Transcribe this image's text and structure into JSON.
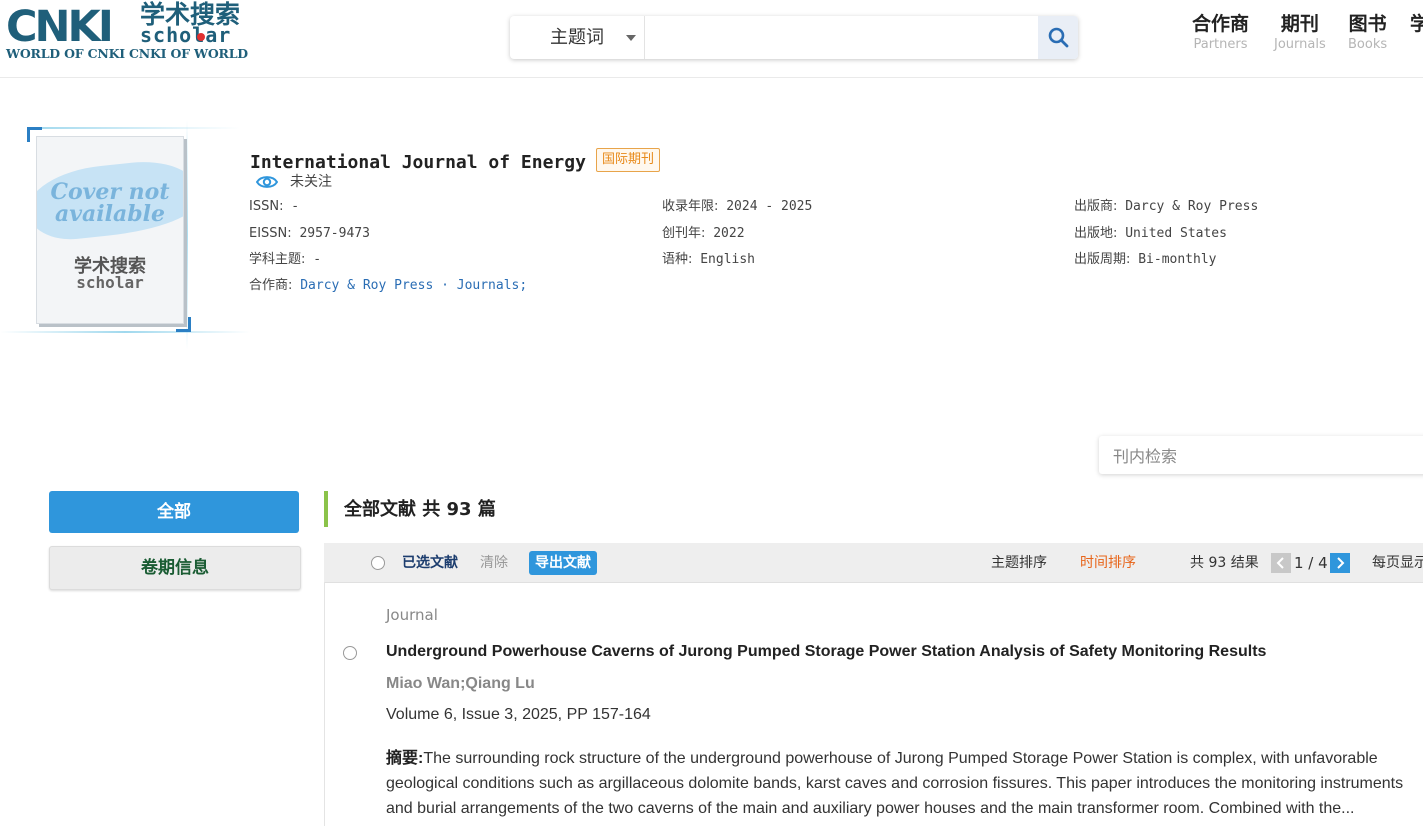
{
  "header": {
    "logo_main": "CNKI",
    "logo_cn": "学术搜索",
    "logo_scholar": "scholar",
    "logo_sub": "WORLD OF CNKI CNKI OF WORLD",
    "search": {
      "field_selected": "主题词",
      "placeholder": ""
    },
    "nav": [
      {
        "cn": "合作商",
        "en": "Partners"
      },
      {
        "cn": "期刊",
        "en": "Journals"
      },
      {
        "cn": "图书",
        "en": "Books"
      },
      {
        "cn": "学",
        "en": ""
      }
    ]
  },
  "journal": {
    "cover_text": "Cover not available",
    "cover_logo_cn": "学术搜索",
    "cover_logo_en": "scholar",
    "title": "International Journal of Energy",
    "badge": "国际期刊",
    "follow_label": "未关注",
    "col1": [
      {
        "label": "ISSN:",
        "value": " -"
      },
      {
        "label": "EISSN:",
        "value": " 2957-9473"
      },
      {
        "label": "学科主题:",
        "value": " -"
      }
    ],
    "partners_label": "合作商:",
    "partners_value": " Darcy & Roy Press · Journals;",
    "col2": [
      {
        "label": "收录年限:",
        "value": " 2024 - 2025"
      },
      {
        "label": "创刊年:",
        "value": " 2022"
      },
      {
        "label": "语种:",
        "value": " English"
      }
    ],
    "col3": [
      {
        "label": "出版商:",
        "value": " Darcy & Roy Press"
      },
      {
        "label": "出版地:",
        "value": " United States"
      },
      {
        "label": "出版周期:",
        "value": " Bi-monthly"
      }
    ]
  },
  "inner_search": {
    "placeholder": "刊内检索"
  },
  "sidebar": {
    "all": "全部",
    "volume_info": "卷期信息"
  },
  "results": {
    "heading": "全部文献 共 93 篇",
    "toolbar": {
      "selected": "已选文献",
      "clear": "清除",
      "export": "导出文献",
      "sort_subject": "主题排序",
      "sort_time": "时间排序",
      "total": "共 93 结果",
      "page": "1 / 4",
      "per_page": "每页显示"
    },
    "items": [
      {
        "type": "Journal",
        "title": "Underground Powerhouse Caverns of Jurong Pumped Storage Power Station Analysis of Safety Monitoring Results",
        "authors": "Miao Wan;Qiang Lu",
        "volume": "Volume 6, Issue 3, 2025, PP 157-164",
        "abstract_label": "摘要:",
        "abstract_lines": [
          "The surrounding rock structure of the underground powerhouse of Jurong Pumped Storage Power Station is complex, with unfavorable",
          "geological conditions such as argillaceous dolomite bands, karst caves and corrosion fissures. This paper introduces the monitoring instruments",
          "and burial arrangements of the two caverns of the main and auxiliary power houses and the main transformer room. Combined with the..."
        ]
      }
    ]
  },
  "colors": {
    "brand": "#1f5f7a",
    "accent_blue": "#2f96dc",
    "sort_active": "#e8651a",
    "link": "#2a6db4",
    "badge": "#e88a1a",
    "green_bar": "#8bc34a"
  }
}
